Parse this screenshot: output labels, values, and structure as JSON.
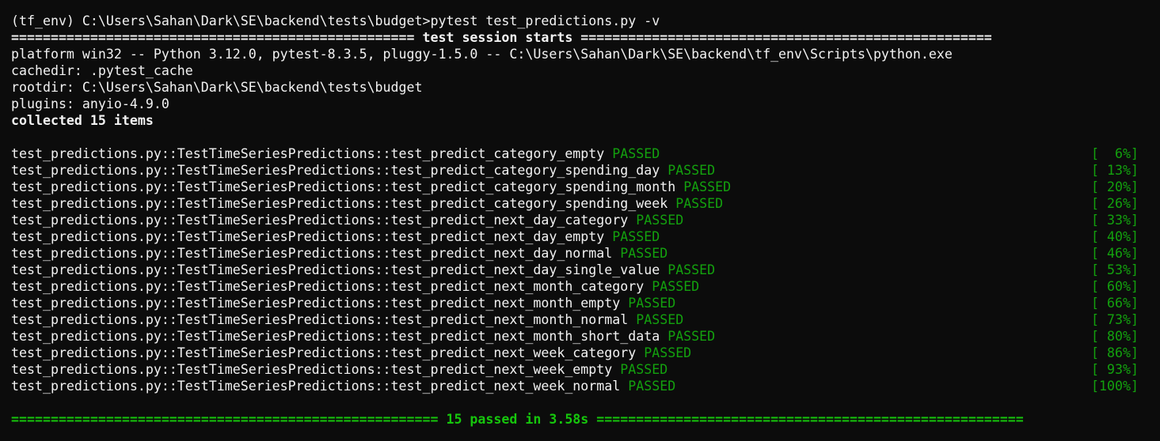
{
  "terminal": {
    "prompt_line": "(tf_env) C:\\Users\\Sahan\\Dark\\SE\\backend\\tests\\budget>pytest test_predictions.py -v",
    "session_header": "=================================================== test session starts ====================================================",
    "platform": "platform win32 -- Python 3.12.0, pytest-8.3.5, pluggy-1.5.0 -- C:\\Users\\Sahan\\Dark\\SE\\backend\\tf_env\\Scripts\\python.exe",
    "cachedir": "cachedir: .pytest_cache",
    "rootdir": "rootdir: C:\\Users\\Sahan\\Dark\\SE\\backend\\tests\\budget",
    "plugins": "plugins: anyio-4.9.0",
    "collected": "collected 15 items",
    "tests": [
      {
        "name": "test_predictions.py::TestTimeSeriesPredictions::test_predict_category_empty",
        "status": "PASSED",
        "progress": "[  6%]"
      },
      {
        "name": "test_predictions.py::TestTimeSeriesPredictions::test_predict_category_spending_day",
        "status": "PASSED",
        "progress": "[ 13%]"
      },
      {
        "name": "test_predictions.py::TestTimeSeriesPredictions::test_predict_category_spending_month",
        "status": "PASSED",
        "progress": "[ 20%]"
      },
      {
        "name": "test_predictions.py::TestTimeSeriesPredictions::test_predict_category_spending_week",
        "status": "PASSED",
        "progress": "[ 26%]"
      },
      {
        "name": "test_predictions.py::TestTimeSeriesPredictions::test_predict_next_day_category",
        "status": "PASSED",
        "progress": "[ 33%]"
      },
      {
        "name": "test_predictions.py::TestTimeSeriesPredictions::test_predict_next_day_empty",
        "status": "PASSED",
        "progress": "[ 40%]"
      },
      {
        "name": "test_predictions.py::TestTimeSeriesPredictions::test_predict_next_day_normal",
        "status": "PASSED",
        "progress": "[ 46%]"
      },
      {
        "name": "test_predictions.py::TestTimeSeriesPredictions::test_predict_next_day_single_value",
        "status": "PASSED",
        "progress": "[ 53%]"
      },
      {
        "name": "test_predictions.py::TestTimeSeriesPredictions::test_predict_next_month_category",
        "status": "PASSED",
        "progress": "[ 60%]"
      },
      {
        "name": "test_predictions.py::TestTimeSeriesPredictions::test_predict_next_month_empty",
        "status": "PASSED",
        "progress": "[ 66%]"
      },
      {
        "name": "test_predictions.py::TestTimeSeriesPredictions::test_predict_next_month_normal",
        "status": "PASSED",
        "progress": "[ 73%]"
      },
      {
        "name": "test_predictions.py::TestTimeSeriesPredictions::test_predict_next_month_short_data",
        "status": "PASSED",
        "progress": "[ 80%]"
      },
      {
        "name": "test_predictions.py::TestTimeSeriesPredictions::test_predict_next_week_category",
        "status": "PASSED",
        "progress": "[ 86%]"
      },
      {
        "name": "test_predictions.py::TestTimeSeriesPredictions::test_predict_next_week_empty",
        "status": "PASSED",
        "progress": "[ 93%]"
      },
      {
        "name": "test_predictions.py::TestTimeSeriesPredictions::test_predict_next_week_normal",
        "status": "PASSED",
        "progress": "[100%]"
      }
    ],
    "summary": "====================================================== 15 passed in 3.58s ======================================================"
  },
  "colors": {
    "background": "#0c0c0c",
    "text": "#cccccc",
    "passed": "#13a10e",
    "summary": "#16c60c"
  }
}
